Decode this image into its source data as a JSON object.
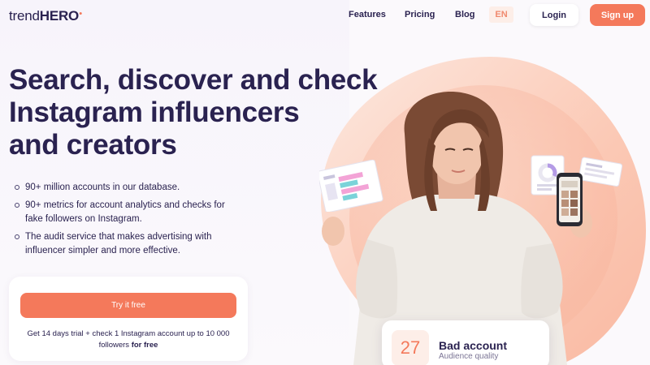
{
  "header": {
    "logo_light": "trend",
    "logo_bold": "HERO",
    "nav": [
      "Features",
      "Pricing",
      "Blog"
    ],
    "lang": "EN",
    "login": "Login",
    "signup": "Sign up"
  },
  "hero": {
    "headline_lines": [
      "Search, discover and check",
      "Instagram influencers",
      "and creators"
    ],
    "bullets": [
      "90+ million accounts in our database.",
      "90+ metrics for account analytics and checks for fake followers on Instagram.",
      "The audit service that makes advertising with influencer simpler and more effective."
    ]
  },
  "cta": {
    "button": "Try it free",
    "note_main": "Get 14 days trial + check 1 Instagram account up to 10 000 followers",
    "note_bold": "for free"
  },
  "metric_card": {
    "value": "27",
    "title": "Bad account",
    "subtitle": "Audience quality"
  },
  "colors": {
    "accent": "#f4795b",
    "text": "#2a2250",
    "blob": "#fbc8b4"
  }
}
